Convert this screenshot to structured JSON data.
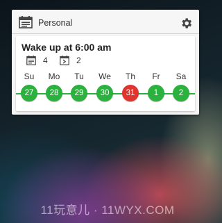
{
  "header": {
    "title": "Personal",
    "calendar_icon": "calendar-icon",
    "settings_icon": "gear-icon"
  },
  "card": {
    "alarm_title": "Wake up at 6:00 am",
    "stats": [
      {
        "icon": "calendar-list-icon",
        "value": "4"
      },
      {
        "icon": "calendar-skip-icon",
        "value": "2"
      }
    ]
  },
  "week": {
    "days": [
      {
        "label": "Su",
        "date": "27",
        "state": "on"
      },
      {
        "label": "Mo",
        "date": "28",
        "state": "on"
      },
      {
        "label": "Tu",
        "date": "29",
        "state": "on"
      },
      {
        "label": "We",
        "date": "30",
        "state": "on"
      },
      {
        "label": "Th",
        "date": "31",
        "state": "off"
      },
      {
        "label": "Fr",
        "date": "1",
        "state": "on"
      },
      {
        "label": "Sa",
        "date": "2",
        "state": "on"
      }
    ]
  },
  "colors": {
    "on": "#2bb13d",
    "off": "#e0352e",
    "line": "#2bb13d"
  },
  "watermark": "11玩意儿 · 11WYX.COM"
}
